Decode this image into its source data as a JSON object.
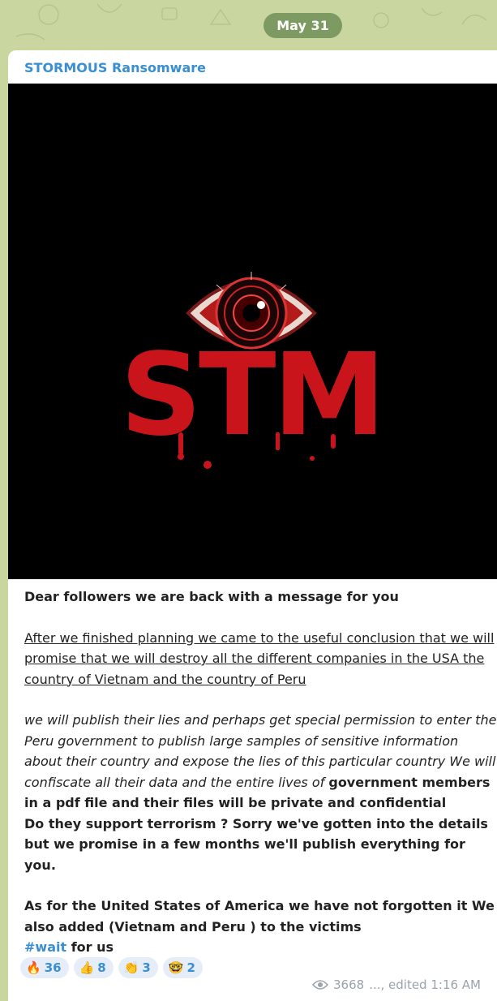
{
  "date_separator": "May 31",
  "channel": {
    "name": "STORMOUS Ransomware"
  },
  "media": {
    "logo_text": "STM",
    "icon": "eye-logo"
  },
  "message": {
    "line1": "Dear followers we are back with a message for you",
    "para2": "After we finished planning we came to the useful conclusion that we will promise that we will destroy all the different companies in the USA the country of Vietnam and the country of Peru",
    "para3_italic": "we will publish their lies and perhaps get special permission to enter the Peru government to publish large samples of sensitive information about their country and expose the lies of this particular country We will confiscate all their data and the entire lives of ",
    "para3_bold": "government members in a pdf file and their files will be private and confidential",
    "para4": "Do they support terrorism ? Sorry we've gotten into the details but we promise in a few months we'll publish everything for you.",
    "para5": "As for the United States of America we have not forgotten it We also added (Vietnam and Peru ) to the victims",
    "hashtag": "#wait",
    "hashtag_suffix": " for us"
  },
  "reactions": [
    {
      "emoji": "🔥",
      "count": "36"
    },
    {
      "emoji": "👍",
      "count": "8"
    },
    {
      "emoji": "👏",
      "count": "3"
    },
    {
      "emoji": "🤓",
      "count": "2"
    }
  ],
  "meta": {
    "views": "3668",
    "edited": "..., edited 1:16 AM"
  }
}
